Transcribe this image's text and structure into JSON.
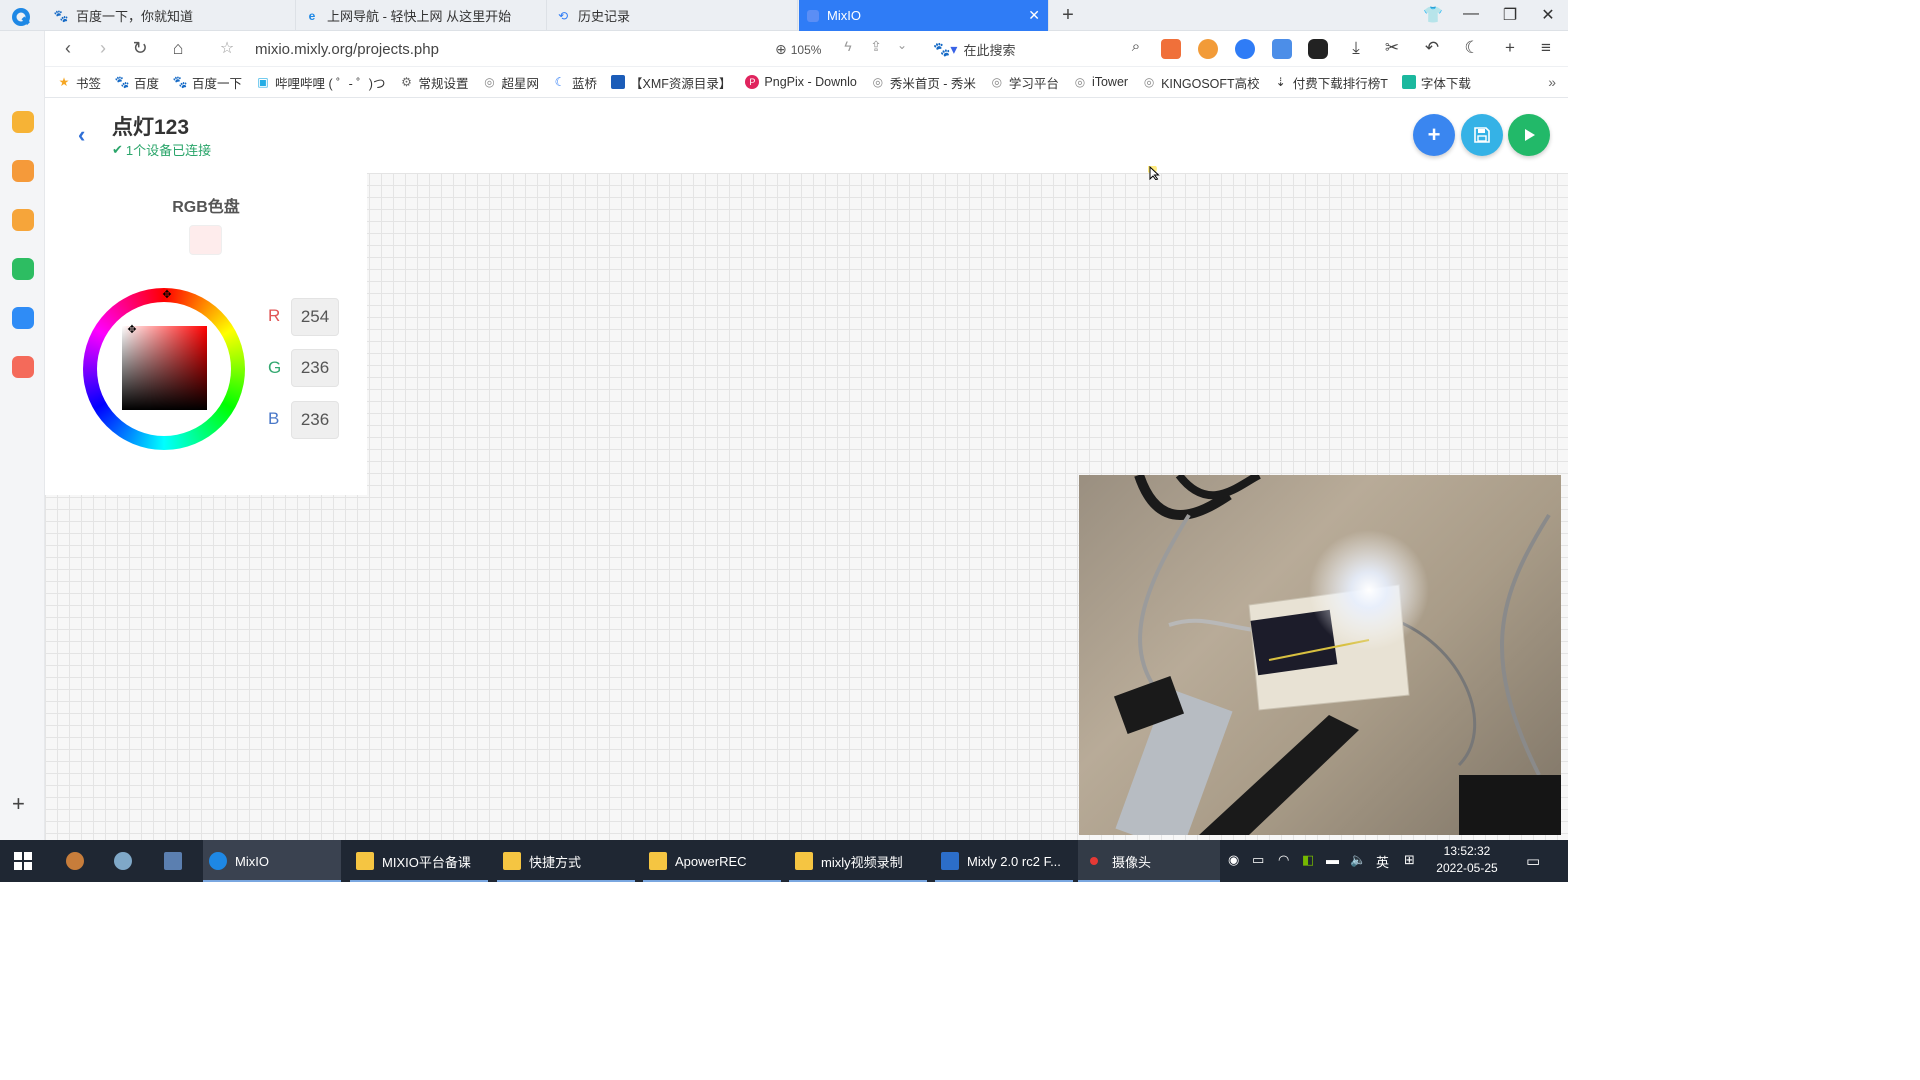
{
  "browser": {
    "tabs": [
      {
        "label": "百度一下，你就知道",
        "icon": "baidu-icon"
      },
      {
        "label": "上网导航 - 轻快上网 从这里开始",
        "icon": "ie-icon"
      },
      {
        "label": "历史记录",
        "icon": "history-icon"
      },
      {
        "label": "MixIO",
        "icon": "mixio-icon",
        "active": true
      }
    ],
    "url": "mixio.mixly.org/projects.php",
    "zoom": "105%",
    "search_label": "在此搜索",
    "bookmarks": [
      {
        "label": "书签",
        "icon": "star-icon"
      },
      {
        "label": "百度",
        "icon": "baidu-icon"
      },
      {
        "label": "百度一下",
        "icon": "baidu-icon"
      },
      {
        "label": "哔哩哔哩 ( ゜- ゜)つ",
        "icon": "bilibili-icon"
      },
      {
        "label": "常规设置",
        "icon": "settings-icon"
      },
      {
        "label": "超星网",
        "icon": "globe-icon"
      },
      {
        "label": "蓝桥",
        "icon": "lanqiao-icon"
      },
      {
        "label": "【XMF资源目录】",
        "icon": "folder-icon"
      },
      {
        "label": "PngPix - Downlo",
        "icon": "pngpix-icon"
      },
      {
        "label": "秀米首页 - 秀米",
        "icon": "globe-icon"
      },
      {
        "label": "学习平台",
        "icon": "globe-icon"
      },
      {
        "label": "iTower",
        "icon": "globe-icon"
      },
      {
        "label": "KINGOSOFT高校",
        "icon": "globe-icon"
      },
      {
        "label": "付费下载排行榜T",
        "icon": "download-icon"
      },
      {
        "label": "字体下载",
        "icon": "font-icon"
      }
    ]
  },
  "project": {
    "title": "点灯123",
    "connection_status": "1个设备已连接"
  },
  "rgb_widget": {
    "title": "RGB色盘",
    "swatch_color": "#feecec",
    "r_label": "R",
    "g_label": "G",
    "b_label": "B",
    "r": "254",
    "g": "236",
    "b": "236"
  },
  "colors": {
    "accent_blue": "#2f7cf6",
    "add_button": "#3a86f0",
    "save_button": "#35b2e6",
    "run_button": "#22b969",
    "connected_green": "#2aa56a"
  },
  "taskbar": {
    "items": [
      {
        "label": "MixIO"
      },
      {
        "label": "MIXIO平台备课"
      },
      {
        "label": "快捷方式"
      },
      {
        "label": "ApowerREC"
      },
      {
        "label": "mixly视频录制"
      },
      {
        "label": "Mixly 2.0 rc2 F..."
      },
      {
        "label": "摄像头"
      }
    ],
    "ime": "英",
    "time": "13:52:32",
    "date": "2022-05-25"
  }
}
